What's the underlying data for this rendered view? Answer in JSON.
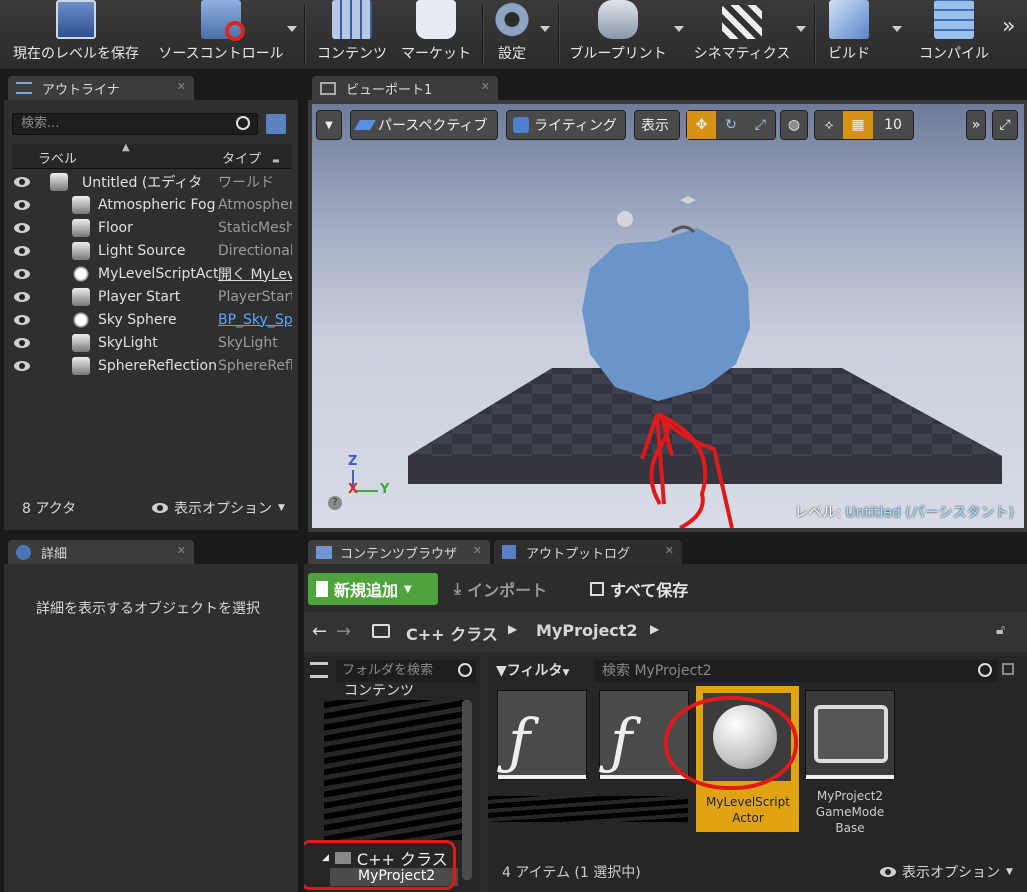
{
  "toolbar": {
    "items": [
      {
        "label": "現在のレベルを保存",
        "icon": "save-icon"
      },
      {
        "label": "ソースコントロール",
        "icon": "source-control-icon"
      },
      {
        "label": "コンテンツ",
        "icon": "content-icon"
      },
      {
        "label": "マーケット",
        "icon": "marketplace-icon"
      },
      {
        "label": "設定",
        "icon": "settings-icon"
      },
      {
        "label": "ブループリント",
        "icon": "blueprint-icon"
      },
      {
        "label": "シネマティクス",
        "icon": "cinematics-icon"
      },
      {
        "label": "ビルド",
        "icon": "build-icon"
      },
      {
        "label": "コンパイル",
        "icon": "compile-icon"
      }
    ],
    "overflow": "»"
  },
  "outliner": {
    "tab": "アウトライナ",
    "search_placeholder": "検索...",
    "col_label": "ラベル",
    "col_type": "タイプ",
    "rows": [
      {
        "label": "Untitled (エディタ)",
        "type": "ワールド"
      },
      {
        "label": "Atmospheric Fog",
        "type": "AtmosphericFog"
      },
      {
        "label": "Floor",
        "type": "StaticMeshActor"
      },
      {
        "label": "Light Source",
        "type": "DirectionalLight"
      },
      {
        "label": "MyLevelScriptActor",
        "type": "開く MyLevel"
      },
      {
        "label": "Player Start",
        "type": "PlayerStart"
      },
      {
        "label": "Sky Sphere",
        "type": "BP_Sky_Sphere"
      },
      {
        "label": "SkyLight",
        "type": "SkyLight"
      },
      {
        "label": "SphereReflection",
        "type": "SphereReflectionCapture"
      }
    ],
    "count": "8 アクタ",
    "view_options": "表示オプション"
  },
  "details": {
    "tab": "詳細",
    "hint": "詳細を表示するオブジェクトを選択"
  },
  "viewport": {
    "tab": "ビューポート1",
    "perspective": "パースペクティブ",
    "lighting": "ライティング",
    "show": "表示",
    "grid_snap": "10",
    "level_prefix": "レベル:",
    "level_name": "Untitled (パーシスタント)",
    "axis_z": "Z",
    "axis_x": "X",
    "axis_y": "Y"
  },
  "content_browser": {
    "tab": "コンテンツブラウザ",
    "tab2": "アウトプットログ",
    "add_new": "新規追加",
    "import": "インポート",
    "save_all": "すべて保存",
    "path": [
      "C++ クラス",
      "MyProject2"
    ],
    "folder_search_placeholder": "フォルダを検索",
    "filter": "フィルタ",
    "asset_search_placeholder": "検索 MyProject2",
    "tree_top": "コンテンツ",
    "tree_cpp": "C++ クラス",
    "tree_project": "MyProject2",
    "assets": [
      {
        "name": ""
      },
      {
        "name": ""
      },
      {
        "name": "MyLevelScript Actor"
      },
      {
        "name": "MyProject2 GameMode Base"
      }
    ],
    "status": "4 アイテム (1 選択中)",
    "view_options": "表示オプション"
  },
  "colors": {
    "accent_green": "#4fa33d",
    "selection_orange": "#e0a412",
    "annotation_red": "#e01a1a",
    "link_blue": "#5aa7ff"
  }
}
